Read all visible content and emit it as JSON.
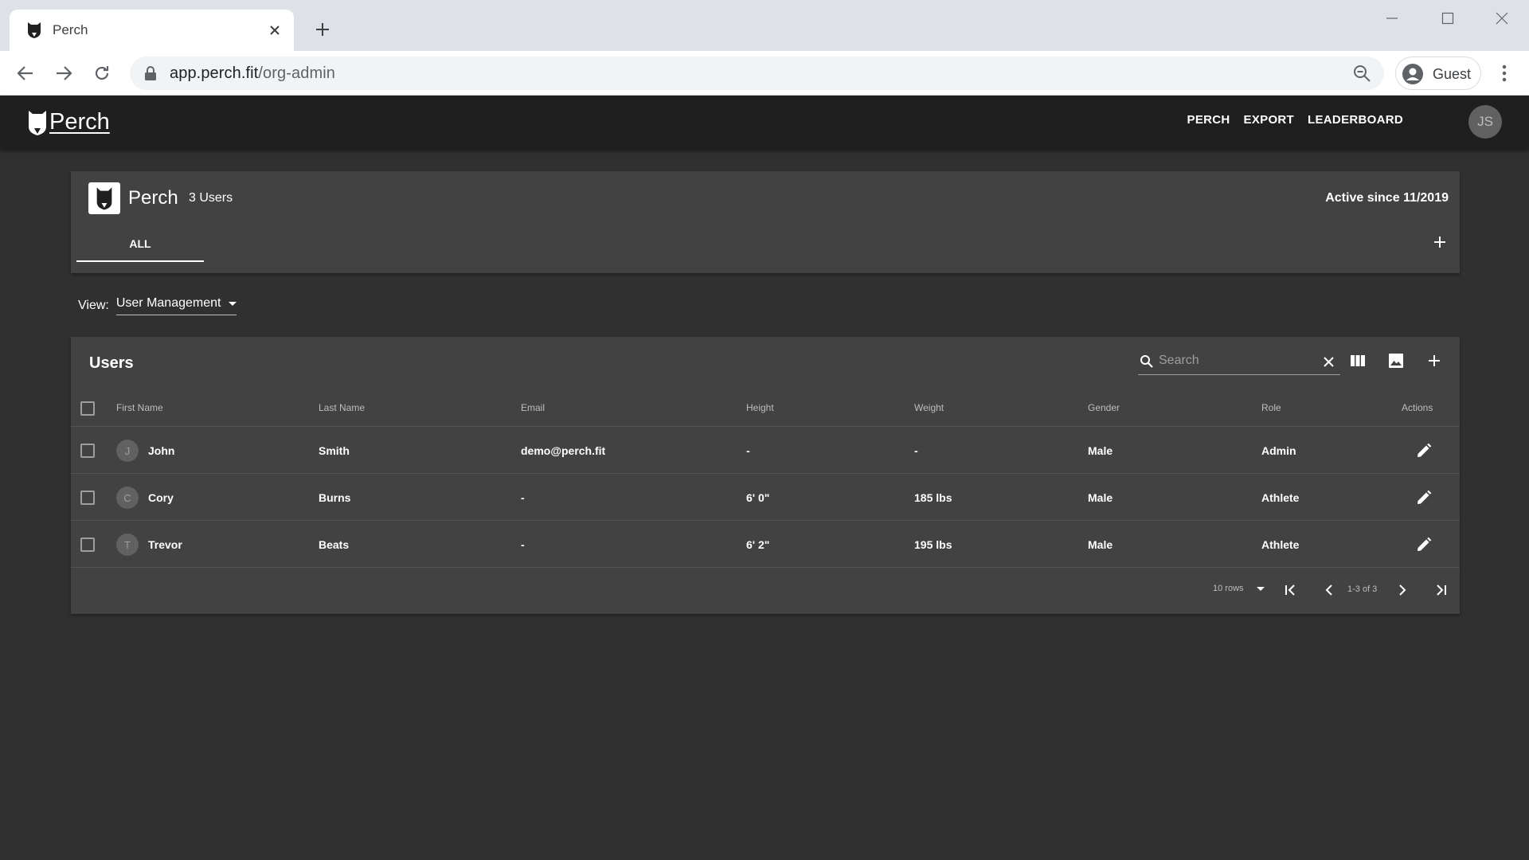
{
  "browser": {
    "tab_title": "Perch",
    "url_host": "app.perch.fit",
    "url_path": "/org-admin",
    "profile_name": "Guest"
  },
  "header": {
    "brand": "Perch",
    "nav": [
      "PERCH",
      "EXPORT",
      "LEADERBOARD"
    ],
    "user_initials": "JS"
  },
  "org": {
    "name": "Perch",
    "user_count": "3 Users",
    "active_since": "Active since 11/2019",
    "tabs": [
      "ALL"
    ]
  },
  "view": {
    "label": "View:",
    "selected": "User Management"
  },
  "users_table": {
    "title": "Users",
    "search_placeholder": "Search",
    "columns": [
      "First Name",
      "Last Name",
      "Email",
      "Height",
      "Weight",
      "Gender",
      "Role",
      "Actions"
    ],
    "rows": [
      {
        "initial": "J",
        "first": "John",
        "last": "Smith",
        "email": "demo@perch.fit",
        "height": "-",
        "weight": "-",
        "gender": "Male",
        "role": "Admin"
      },
      {
        "initial": "C",
        "first": "Cory",
        "last": "Burns",
        "email": "-",
        "height": "6' 0\"",
        "weight": "185 lbs",
        "gender": "Male",
        "role": "Athlete"
      },
      {
        "initial": "T",
        "first": "Trevor",
        "last": "Beats",
        "email": "-",
        "height": "6' 2\"",
        "weight": "195 lbs",
        "gender": "Male",
        "role": "Athlete"
      }
    ],
    "pagination": {
      "rows_per_page": "10 rows",
      "range": "1-3 of 3"
    }
  },
  "icons": {
    "back": "arrow-left-icon",
    "forward": "arrow-right-icon",
    "reload": "reload-icon",
    "lock": "lock-icon",
    "zoom": "zoom-icon",
    "search": "search-icon",
    "clear": "close-icon",
    "columns": "view-column-icon",
    "image": "image-icon",
    "add": "plus-icon",
    "edit": "pencil-icon"
  },
  "colors": {
    "page_bg": "#303030",
    "card_bg": "#424242",
    "appbar_bg": "#1f1f1f",
    "text": "#ffffff",
    "muted": "#bdbdbd"
  }
}
